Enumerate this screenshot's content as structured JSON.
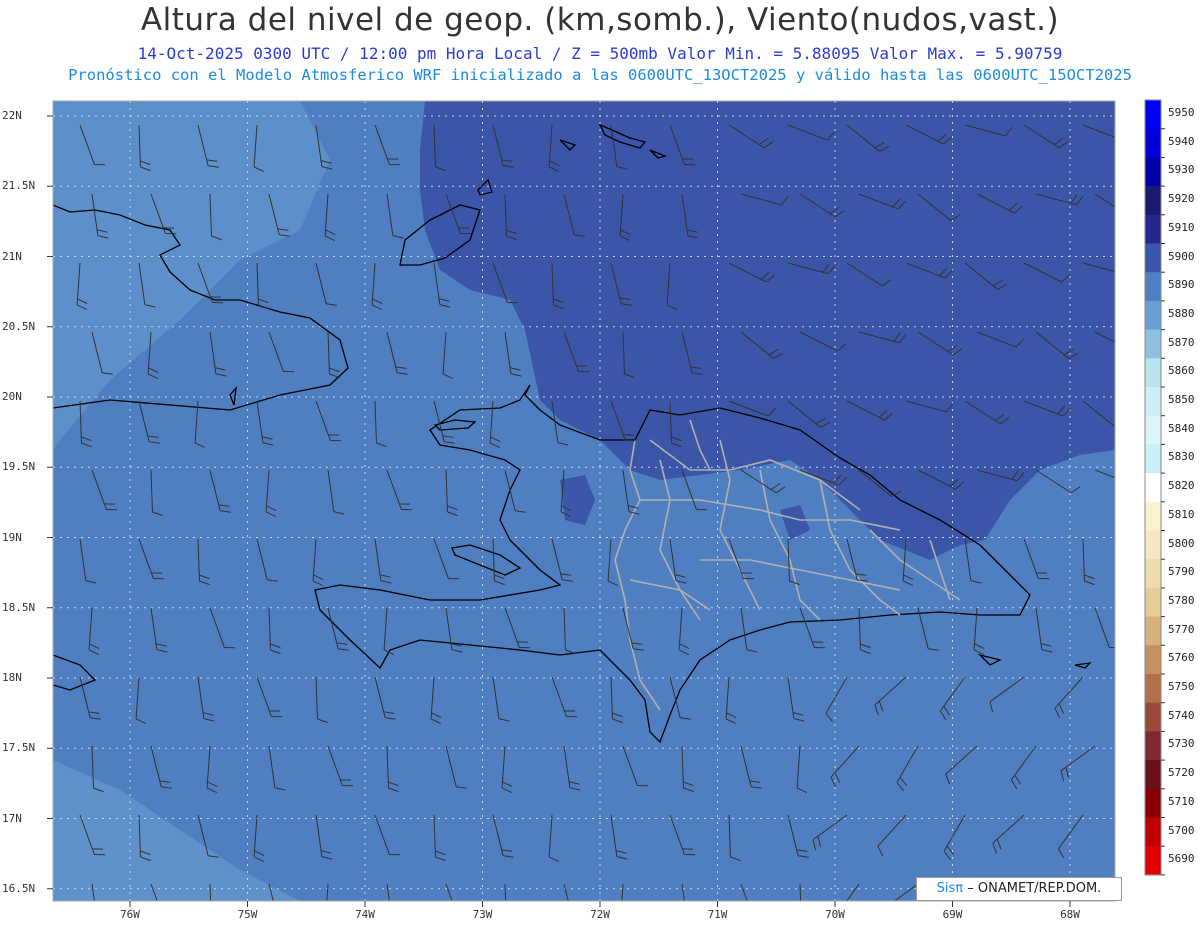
{
  "header": {
    "title": "Altura del nivel de geop. (km,somb.), Viento(nudos,vast.)",
    "line1": "14-Oct-2025  0300 UTC / 12:00 pm Hora Local / Z = 500mb    Valor Min. = 5.88095  Valor Max. = 5.90759",
    "line2": "Pronóstico con el Modelo Atmosferico WRF inicializado a las 0600UTC_13OCT2025 y válido hasta las  0600UTC_15OCT2025"
  },
  "axes": {
    "lat_labels": [
      "22N",
      "21.5N",
      "21N",
      "20.5N",
      "20N",
      "19.5N",
      "19N",
      "18.5N",
      "18N",
      "17.5N",
      "17N",
      "16.5N"
    ],
    "lon_labels": [
      "76W",
      "75W",
      "74W",
      "73W",
      "72W",
      "71W",
      "70W",
      "69W",
      "68W"
    ]
  },
  "colorbar": {
    "levels": [
      "5950",
      "5940",
      "5930",
      "5920",
      "5910",
      "5900",
      "5890",
      "5880",
      "5870",
      "5860",
      "5850",
      "5840",
      "5830",
      "5820",
      "5810",
      "5800",
      "5790",
      "5780",
      "5770",
      "5760",
      "5750",
      "5740",
      "5730",
      "5720",
      "5710",
      "5700",
      "5690"
    ],
    "colors": [
      "#0000ff",
      "#0000dd",
      "#0000a8",
      "#1a1a70",
      "#26288f",
      "#3b56a8",
      "#4f7fc0",
      "#6a9dd2",
      "#8dc0e0",
      "#b8e2ee",
      "#cdeff5",
      "#dcf5f9",
      "#c8f0f6",
      "#ffffff",
      "#fbf3d0",
      "#f6e8c0",
      "#eedcae",
      "#e6cc98",
      "#d8b07c",
      "#c69060",
      "#b4704c",
      "#9a4a3a",
      "#802a30",
      "#6a1018",
      "#8a0000",
      "#c00000",
      "#e40000"
    ]
  },
  "map": {
    "field_colors": {
      "main": "#4f7fc0",
      "high": "#3b56a8",
      "low": "#6a9dd2"
    },
    "coastline_color": "#000000",
    "province_border_color": "#b0b0b0",
    "barb_color": "#333333"
  },
  "credit": {
    "sis": "Sisπ",
    "rest": "– ONAMET/REP.DOM."
  }
}
